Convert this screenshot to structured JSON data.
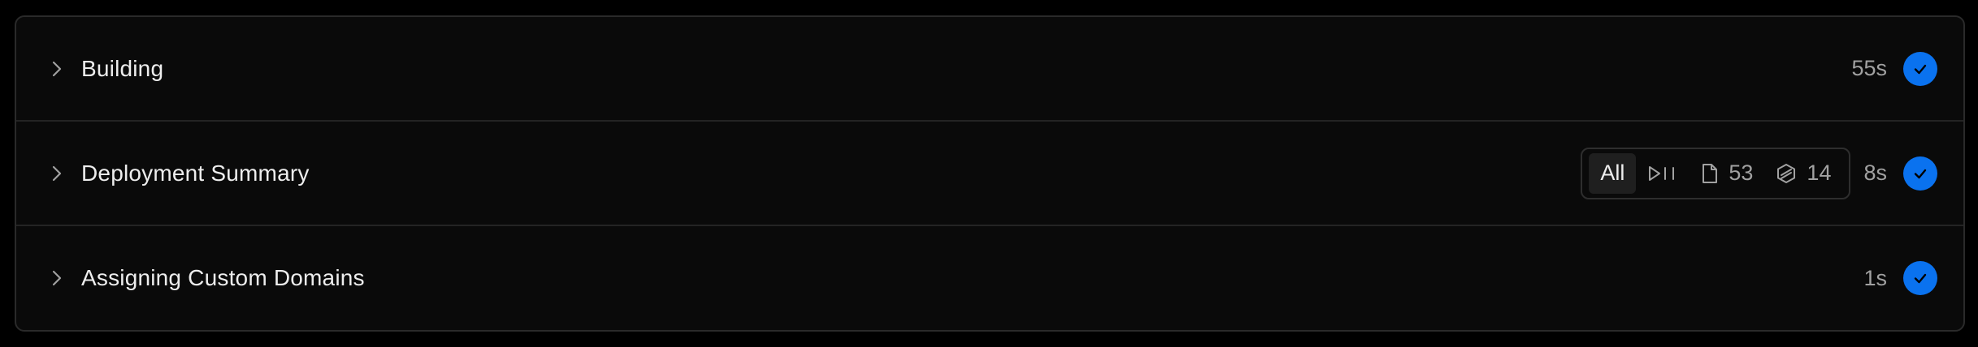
{
  "colors": {
    "background": "#000000",
    "panel": "#0a0a0a",
    "border": "#2a2a2a",
    "text": "#ededed",
    "muted": "#a1a1a1",
    "success": "#0a72ef"
  },
  "steps": [
    {
      "title": "Building",
      "duration": "55s",
      "status_icon": "check-icon",
      "expand_icon": "chevron-right-icon"
    },
    {
      "title": "Deployment Summary",
      "duration": "8s",
      "status_icon": "check-icon",
      "expand_icon": "chevron-right-icon",
      "filter": {
        "selected": "All",
        "options": [
          {
            "label": "All",
            "icon": ""
          },
          {
            "label": "",
            "icon": "play-pause-icon"
          },
          {
            "label": "53",
            "icon": "file-icon"
          },
          {
            "label": "14",
            "icon": "functions-icon"
          }
        ]
      }
    },
    {
      "title": "Assigning Custom Domains",
      "duration": "1s",
      "status_icon": "check-icon",
      "expand_icon": "chevron-right-icon"
    }
  ]
}
